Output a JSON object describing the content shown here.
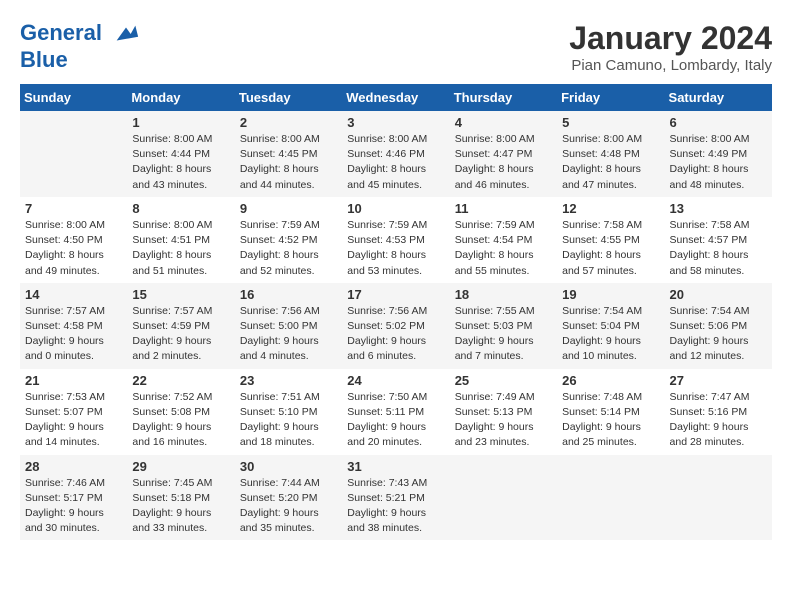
{
  "header": {
    "logo_line1": "General",
    "logo_line2": "Blue",
    "month": "January 2024",
    "location": "Pian Camuno, Lombardy, Italy"
  },
  "calendar": {
    "days_of_week": [
      "Sunday",
      "Monday",
      "Tuesday",
      "Wednesday",
      "Thursday",
      "Friday",
      "Saturday"
    ],
    "weeks": [
      [
        {
          "date": "",
          "sunrise": "",
          "sunset": "",
          "daylight": ""
        },
        {
          "date": "1",
          "sunrise": "Sunrise: 8:00 AM",
          "sunset": "Sunset: 4:44 PM",
          "daylight": "Daylight: 8 hours and 43 minutes."
        },
        {
          "date": "2",
          "sunrise": "Sunrise: 8:00 AM",
          "sunset": "Sunset: 4:45 PM",
          "daylight": "Daylight: 8 hours and 44 minutes."
        },
        {
          "date": "3",
          "sunrise": "Sunrise: 8:00 AM",
          "sunset": "Sunset: 4:46 PM",
          "daylight": "Daylight: 8 hours and 45 minutes."
        },
        {
          "date": "4",
          "sunrise": "Sunrise: 8:00 AM",
          "sunset": "Sunset: 4:47 PM",
          "daylight": "Daylight: 8 hours and 46 minutes."
        },
        {
          "date": "5",
          "sunrise": "Sunrise: 8:00 AM",
          "sunset": "Sunset: 4:48 PM",
          "daylight": "Daylight: 8 hours and 47 minutes."
        },
        {
          "date": "6",
          "sunrise": "Sunrise: 8:00 AM",
          "sunset": "Sunset: 4:49 PM",
          "daylight": "Daylight: 8 hours and 48 minutes."
        }
      ],
      [
        {
          "date": "7",
          "sunrise": "Sunrise: 8:00 AM",
          "sunset": "Sunset: 4:50 PM",
          "daylight": "Daylight: 8 hours and 49 minutes."
        },
        {
          "date": "8",
          "sunrise": "Sunrise: 8:00 AM",
          "sunset": "Sunset: 4:51 PM",
          "daylight": "Daylight: 8 hours and 51 minutes."
        },
        {
          "date": "9",
          "sunrise": "Sunrise: 7:59 AM",
          "sunset": "Sunset: 4:52 PM",
          "daylight": "Daylight: 8 hours and 52 minutes."
        },
        {
          "date": "10",
          "sunrise": "Sunrise: 7:59 AM",
          "sunset": "Sunset: 4:53 PM",
          "daylight": "Daylight: 8 hours and 53 minutes."
        },
        {
          "date": "11",
          "sunrise": "Sunrise: 7:59 AM",
          "sunset": "Sunset: 4:54 PM",
          "daylight": "Daylight: 8 hours and 55 minutes."
        },
        {
          "date": "12",
          "sunrise": "Sunrise: 7:58 AM",
          "sunset": "Sunset: 4:55 PM",
          "daylight": "Daylight: 8 hours and 57 minutes."
        },
        {
          "date": "13",
          "sunrise": "Sunrise: 7:58 AM",
          "sunset": "Sunset: 4:57 PM",
          "daylight": "Daylight: 8 hours and 58 minutes."
        }
      ],
      [
        {
          "date": "14",
          "sunrise": "Sunrise: 7:57 AM",
          "sunset": "Sunset: 4:58 PM",
          "daylight": "Daylight: 9 hours and 0 minutes."
        },
        {
          "date": "15",
          "sunrise": "Sunrise: 7:57 AM",
          "sunset": "Sunset: 4:59 PM",
          "daylight": "Daylight: 9 hours and 2 minutes."
        },
        {
          "date": "16",
          "sunrise": "Sunrise: 7:56 AM",
          "sunset": "Sunset: 5:00 PM",
          "daylight": "Daylight: 9 hours and 4 minutes."
        },
        {
          "date": "17",
          "sunrise": "Sunrise: 7:56 AM",
          "sunset": "Sunset: 5:02 PM",
          "daylight": "Daylight: 9 hours and 6 minutes."
        },
        {
          "date": "18",
          "sunrise": "Sunrise: 7:55 AM",
          "sunset": "Sunset: 5:03 PM",
          "daylight": "Daylight: 9 hours and 7 minutes."
        },
        {
          "date": "19",
          "sunrise": "Sunrise: 7:54 AM",
          "sunset": "Sunset: 5:04 PM",
          "daylight": "Daylight: 9 hours and 10 minutes."
        },
        {
          "date": "20",
          "sunrise": "Sunrise: 7:54 AM",
          "sunset": "Sunset: 5:06 PM",
          "daylight": "Daylight: 9 hours and 12 minutes."
        }
      ],
      [
        {
          "date": "21",
          "sunrise": "Sunrise: 7:53 AM",
          "sunset": "Sunset: 5:07 PM",
          "daylight": "Daylight: 9 hours and 14 minutes."
        },
        {
          "date": "22",
          "sunrise": "Sunrise: 7:52 AM",
          "sunset": "Sunset: 5:08 PM",
          "daylight": "Daylight: 9 hours and 16 minutes."
        },
        {
          "date": "23",
          "sunrise": "Sunrise: 7:51 AM",
          "sunset": "Sunset: 5:10 PM",
          "daylight": "Daylight: 9 hours and 18 minutes."
        },
        {
          "date": "24",
          "sunrise": "Sunrise: 7:50 AM",
          "sunset": "Sunset: 5:11 PM",
          "daylight": "Daylight: 9 hours and 20 minutes."
        },
        {
          "date": "25",
          "sunrise": "Sunrise: 7:49 AM",
          "sunset": "Sunset: 5:13 PM",
          "daylight": "Daylight: 9 hours and 23 minutes."
        },
        {
          "date": "26",
          "sunrise": "Sunrise: 7:48 AM",
          "sunset": "Sunset: 5:14 PM",
          "daylight": "Daylight: 9 hours and 25 minutes."
        },
        {
          "date": "27",
          "sunrise": "Sunrise: 7:47 AM",
          "sunset": "Sunset: 5:16 PM",
          "daylight": "Daylight: 9 hours and 28 minutes."
        }
      ],
      [
        {
          "date": "28",
          "sunrise": "Sunrise: 7:46 AM",
          "sunset": "Sunset: 5:17 PM",
          "daylight": "Daylight: 9 hours and 30 minutes."
        },
        {
          "date": "29",
          "sunrise": "Sunrise: 7:45 AM",
          "sunset": "Sunset: 5:18 PM",
          "daylight": "Daylight: 9 hours and 33 minutes."
        },
        {
          "date": "30",
          "sunrise": "Sunrise: 7:44 AM",
          "sunset": "Sunset: 5:20 PM",
          "daylight": "Daylight: 9 hours and 35 minutes."
        },
        {
          "date": "31",
          "sunrise": "Sunrise: 7:43 AM",
          "sunset": "Sunset: 5:21 PM",
          "daylight": "Daylight: 9 hours and 38 minutes."
        },
        {
          "date": "",
          "sunrise": "",
          "sunset": "",
          "daylight": ""
        },
        {
          "date": "",
          "sunrise": "",
          "sunset": "",
          "daylight": ""
        },
        {
          "date": "",
          "sunrise": "",
          "sunset": "",
          "daylight": ""
        }
      ]
    ]
  }
}
